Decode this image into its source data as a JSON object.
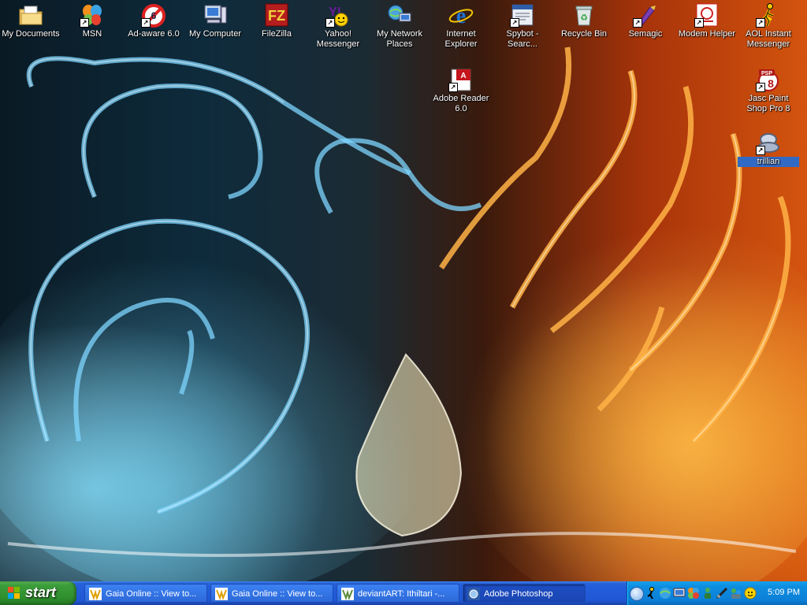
{
  "desktop": {
    "icons": [
      {
        "label": "My Documents",
        "icon": "folder-documents-icon",
        "shortcut": false
      },
      {
        "label": "MSN",
        "icon": "msn-butterfly-icon",
        "shortcut": true
      },
      {
        "label": "Ad-aware 6.0",
        "icon": "adaware-icon",
        "shortcut": true
      },
      {
        "label": "My Computer",
        "icon": "computer-icon",
        "shortcut": false
      },
      {
        "label": "FileZilla",
        "icon": "filezilla-icon",
        "shortcut": false
      },
      {
        "label": "Yahoo! Messenger",
        "icon": "yahoo-messenger-icon",
        "shortcut": true
      },
      {
        "label": "My Network Places",
        "icon": "network-places-icon",
        "shortcut": false
      },
      {
        "label": "Internet Explorer",
        "icon": "internet-explorer-icon",
        "shortcut": false
      },
      {
        "label": "Spybot - Searc...",
        "icon": "spybot-icon",
        "shortcut": true
      },
      {
        "label": "Recycle Bin",
        "icon": "recycle-bin-icon",
        "shortcut": false
      },
      {
        "label": "Semagic",
        "icon": "semagic-icon",
        "shortcut": true
      },
      {
        "label": "Modem Helper",
        "icon": "modem-helper-icon",
        "shortcut": true
      },
      {
        "label": "AOL Instant Messenger",
        "icon": "aim-running-man-icon",
        "shortcut": true
      },
      {
        "label": "Adobe Reader 6.0",
        "icon": "adobe-reader-icon",
        "shortcut": true
      },
      {
        "label": "Jasc Paint Shop Pro 8",
        "icon": "paint-shop-pro-icon",
        "shortcut": true
      },
      {
        "label": "trillian",
        "icon": "trillian-icon",
        "shortcut": true
      }
    ]
  },
  "taskbar": {
    "start_label": "start",
    "tasks": [
      {
        "label": "Gaia Online :: View to...",
        "icon": "gaia-online-icon",
        "active": false
      },
      {
        "label": "Gaia Online :: View to...",
        "icon": "gaia-online-icon",
        "active": false
      },
      {
        "label": "deviantART: Ithiltari -...",
        "icon": "deviantart-icon",
        "active": false
      },
      {
        "label": "Adobe Photoshop",
        "icon": "photoshop-icon",
        "active": true
      }
    ],
    "tray_icons": [
      "aim-tray-icon",
      "network-tray-icon",
      "display-tray-icon",
      "msn-tray-icon",
      "user-tray-icon",
      "modem-tray-icon",
      "messenger-tray-icon",
      "yahoo-tray-icon"
    ],
    "clock": "5:09 PM"
  },
  "colors": {
    "taskbar_blue": "#245edb",
    "start_green": "#3c9e3a",
    "tray_blue": "#0f8ee0",
    "selection_blue": "#316ac5"
  }
}
